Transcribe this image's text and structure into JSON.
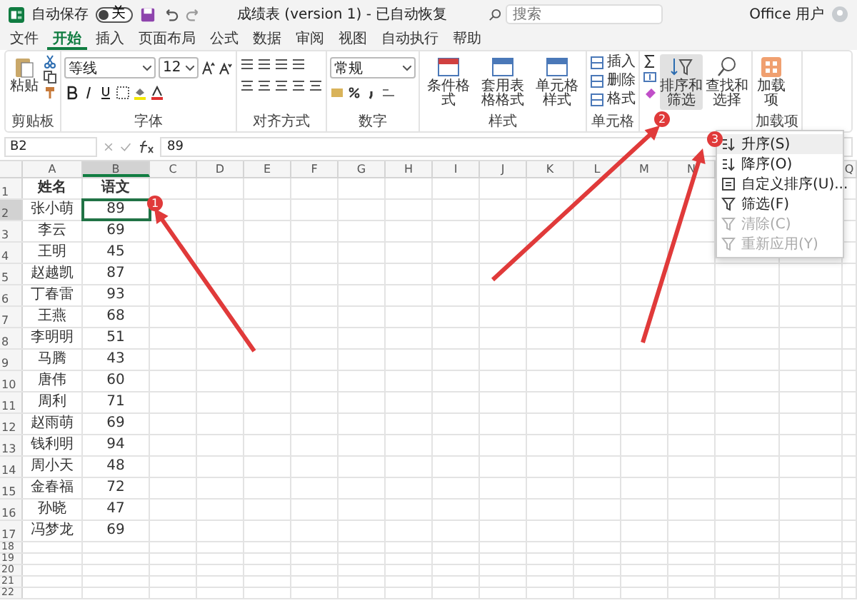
{
  "title_bar": {
    "autosave_label": "自动保存",
    "autosave_toggle": {
      "on": false,
      "label": "关"
    },
    "document_title": "成绩表 (version 1) - 已自动恢复",
    "search": {
      "placeholder": "搜索"
    },
    "user": "Office 用户"
  },
  "tabs": [
    {
      "label": "文件",
      "selected": false
    },
    {
      "label": "开始",
      "selected": true
    },
    {
      "label": "插入",
      "selected": false
    },
    {
      "label": "页面布局",
      "selected": false
    },
    {
      "label": "公式",
      "selected": false
    },
    {
      "label": "数据",
      "selected": false
    },
    {
      "label": "审阅",
      "selected": false
    },
    {
      "label": "视图",
      "selected": false
    },
    {
      "label": "自动执行",
      "selected": false
    },
    {
      "label": "帮助",
      "selected": false
    }
  ],
  "ribbon": [
    {
      "kind": "clipboard",
      "label": "剪贴板",
      "paste": "粘贴"
    },
    {
      "kind": "font",
      "label": "字体",
      "font": "等线",
      "size": "12"
    },
    {
      "kind": "alignment",
      "label": "对齐方式"
    },
    {
      "kind": "number",
      "label": "数字",
      "format": "常规"
    },
    {
      "kind": "styles",
      "label": "样式",
      "buttons": [
        "条件格式",
        "套用表格格式",
        "单元格样式"
      ]
    },
    {
      "kind": "cells",
      "label": "单元格",
      "buttons": [
        "插入",
        "删除",
        "格式"
      ]
    },
    {
      "kind": "editing",
      "buttons": [
        {
          "label": "排序和筛选",
          "selected": true
        },
        {
          "label": "查找和选择",
          "selected": false
        }
      ]
    },
    {
      "kind": "addins",
      "label": "加载项",
      "button": "加载项"
    }
  ],
  "formula_bar": {
    "name_box": "B2",
    "formula": "89"
  },
  "columns": [
    {
      "label": "A",
      "selected": false
    },
    {
      "label": "B",
      "selected": true
    },
    {
      "label": "C",
      "selected": false
    },
    {
      "label": "D",
      "selected": false
    },
    {
      "label": "E",
      "selected": false
    },
    {
      "label": "F",
      "selected": false
    },
    {
      "label": "G",
      "selected": false
    },
    {
      "label": "H",
      "selected": false
    },
    {
      "label": "I",
      "selected": false
    },
    {
      "label": "J",
      "selected": false
    },
    {
      "label": "K",
      "selected": false
    },
    {
      "label": "L",
      "selected": false
    },
    {
      "label": "M",
      "selected": false
    },
    {
      "label": "N",
      "selected": false
    },
    {
      "label": "Q",
      "selected": false
    }
  ],
  "rows": [
    {
      "number": "1",
      "cells": [
        "姓名",
        "语文"
      ],
      "header": true,
      "selected": false
    },
    {
      "number": "2",
      "cells": [
        "张小萌",
        "89"
      ],
      "header": false,
      "selected": true
    },
    {
      "number": "3",
      "cells": [
        "李云",
        "69"
      ],
      "header": false,
      "selected": false
    },
    {
      "number": "4",
      "cells": [
        "王明",
        "45"
      ],
      "header": false,
      "selected": false
    },
    {
      "number": "5",
      "cells": [
        "赵越凯",
        "87"
      ],
      "header": false,
      "selected": false
    },
    {
      "number": "6",
      "cells": [
        "丁春雷",
        "93"
      ],
      "header": false,
      "selected": false
    },
    {
      "number": "7",
      "cells": [
        "王燕",
        "68"
      ],
      "header": false,
      "selected": false
    },
    {
      "number": "8",
      "cells": [
        "李明明",
        "51"
      ],
      "header": false,
      "selected": false
    },
    {
      "number": "9",
      "cells": [
        "马腾",
        "43"
      ],
      "header": false,
      "selected": false
    },
    {
      "number": "10",
      "cells": [
        "唐伟",
        "60"
      ],
      "header": false,
      "selected": false
    },
    {
      "number": "11",
      "cells": [
        "周利",
        "71"
      ],
      "header": false,
      "selected": false
    },
    {
      "number": "12",
      "cells": [
        "赵雨萌",
        "69"
      ],
      "header": false,
      "selected": false
    },
    {
      "number": "13",
      "cells": [
        "钱利明",
        "94"
      ],
      "header": false,
      "selected": false
    },
    {
      "number": "14",
      "cells": [
        "周小天",
        "48"
      ],
      "header": false,
      "selected": false
    },
    {
      "number": "15",
      "cells": [
        "金春福",
        "72"
      ],
      "header": false,
      "selected": false
    },
    {
      "number": "16",
      "cells": [
        "孙晓",
        "47"
      ],
      "header": false,
      "selected": false
    },
    {
      "number": "17",
      "cells": [
        "冯梦龙",
        "69"
      ],
      "header": false,
      "selected": false
    },
    {
      "number": "18",
      "selected": false
    },
    {
      "number": "19",
      "selected": false
    },
    {
      "number": "20",
      "selected": false
    },
    {
      "number": "21",
      "selected": false
    },
    {
      "number": "22",
      "selected": false
    }
  ],
  "sort_menu": {
    "items": [
      {
        "kind": "ascending",
        "label": "升序(S)",
        "disabled": false
      },
      {
        "kind": "descending",
        "label": "降序(O)",
        "disabled": false
      },
      {
        "kind": "custom",
        "label": "自定义排序(U)...",
        "disabled": false
      },
      {
        "kind": "filter",
        "label": "筛选(F)",
        "disabled": false
      },
      {
        "kind": "clear",
        "label": "清除(C)",
        "disabled": true
      },
      {
        "kind": "reapply",
        "label": "重新应用(Y)",
        "disabled": true
      }
    ]
  },
  "annotations": [
    {
      "label": "1"
    },
    {
      "label": "2"
    },
    {
      "label": "3"
    }
  ]
}
